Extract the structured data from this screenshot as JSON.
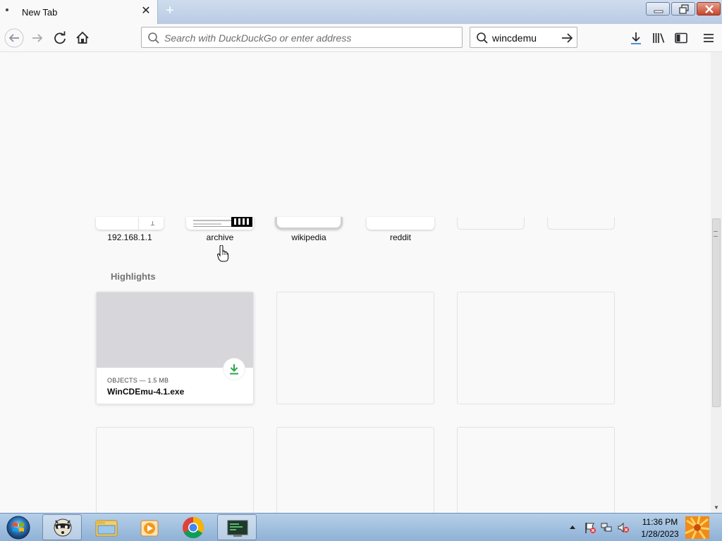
{
  "window": {
    "tab_title": "New Tab",
    "new_tab_symbol": "+",
    "close_tab_symbol": "✕"
  },
  "toolbar": {
    "url_placeholder": "Search with DuckDuckGo or enter address",
    "search_value": "wincdemu"
  },
  "top_sites": [
    {
      "label": "192.168.1.1"
    },
    {
      "label": "archive"
    },
    {
      "label": "wikipedia"
    },
    {
      "label": "reddit"
    },
    {
      "label": ""
    },
    {
      "label": ""
    }
  ],
  "highlights": {
    "title": "Highlights",
    "cards": [
      {
        "meta": "OBJECTS — 1.5 MB",
        "name": "WinCDEmu-4.1.exe"
      }
    ]
  },
  "taskbar": {
    "time": "11:36 PM",
    "date": "1/28/2023"
  },
  "colors": {
    "download_green": "#2ea44f",
    "tab_bar": "#b9cbe3",
    "close_red": "#c8452b"
  }
}
